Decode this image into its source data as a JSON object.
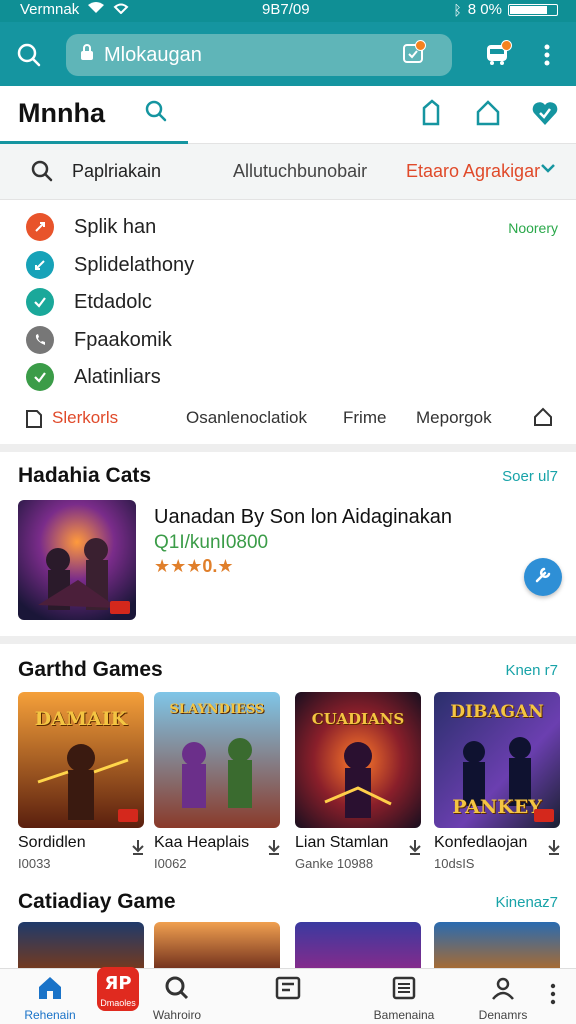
{
  "status_bar": {
    "carrier": "Vermnak",
    "time": "9B7/09",
    "battery": "8 0%",
    "battery_level": 0.85
  },
  "app_bar": {
    "search_text": "Mlokaugan"
  },
  "tab_row": {
    "title": "Mnnha"
  },
  "filter_row": {
    "item1": "Paplriakain",
    "item2": "Allutuchbunobair",
    "item3": "Etaaro Agrakigar"
  },
  "list": {
    "action": "Noorery",
    "items": [
      {
        "label": "Splik han",
        "color": "#e8542b"
      },
      {
        "label": "Splidelathony",
        "color": "#17a2b8"
      },
      {
        "label": "Etdadolc",
        "color": "#1aa89a"
      },
      {
        "label": "Fpaakomik",
        "color": "#777777"
      },
      {
        "label": "Alatinliars",
        "color": "#3b9c48"
      }
    ]
  },
  "subtabs": {
    "tab1": "Slerkorls",
    "tab2": "Osanlenoclatiok",
    "tab3": "Frime",
    "tab4": "Meporgok"
  },
  "section_featured": {
    "title": "Hadahia Cats",
    "action": "Soer ul7",
    "game_title": "Uanadan By Son lon Aidaginakan",
    "game_sub": "Q1I/kunI0800",
    "rating_text": "★★★0.★"
  },
  "section_games": {
    "title": "Garthd Games",
    "action": "Knen r7",
    "cards": [
      {
        "name": "Sordidlen",
        "meta": "I0033",
        "art_text": "DAMAIK"
      },
      {
        "name": "Kaa Heaplais",
        "meta": "I0062",
        "art_text": "SLAYNDIESS"
      },
      {
        "name": "Lian Stamlan",
        "meta": "Ganke 10988",
        "art_text": "CUADIANS"
      },
      {
        "name": "Konfedlaojan",
        "meta": "10dsIS",
        "art_text": "PANKEY"
      }
    ]
  },
  "section_category": {
    "title": "Catiadiay Game",
    "action": "Kinenaz7"
  },
  "bottom_nav": {
    "item1": "Rehenain",
    "item2": "Dmaoles",
    "item3": "Wahroiro",
    "item4": "Bamenaina",
    "item5": "Denamrs"
  }
}
